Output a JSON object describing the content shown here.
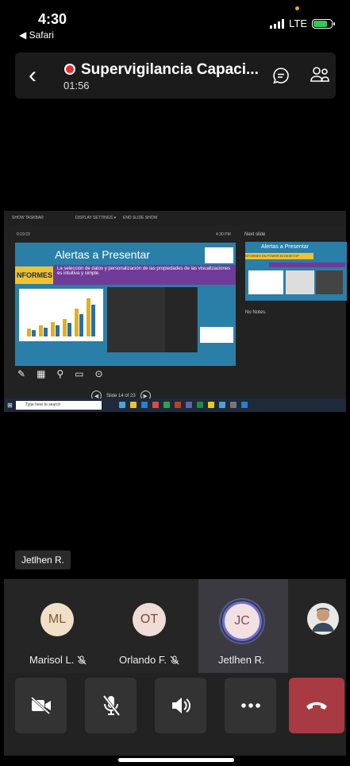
{
  "status_bar": {
    "time": "4:30",
    "back_app": "◀ Safari",
    "network": "LTE"
  },
  "header": {
    "title": "Supervigilancia Capaci...",
    "elapsed": "01:56"
  },
  "shared_screen": {
    "toolbar": [
      "SHOW TASKBAR",
      "DISPLAY SETTINGS ▾",
      "END SLIDE SHOW"
    ],
    "elapsed": "0:19:23",
    "clock": "4:30 PM",
    "slide_title": "Alertas a Presentar",
    "slide_band": "NFORMES EN POWER BI DESKTOP",
    "slide_text": "La selección de datos y personalización de las propiedades de las visualizaciones es intuitiva y simple.",
    "slide_counter": "Slide 14 of 23",
    "next_label": "Next slide",
    "next_title": "Alertas a Presentar",
    "next_band": "NFORMES EN POWER BI DESKTOP",
    "notes": "No Notes.",
    "taskbar_search": "Type here to search"
  },
  "speaker_tag": "Jetlhen R.",
  "participants": [
    {
      "initials": "ML",
      "name": "Marisol L.",
      "muted": true,
      "avatar_color": "#f1dfc8"
    },
    {
      "initials": "OT",
      "name": "Orlando F.",
      "muted": true,
      "avatar_color": "#f0dcd6"
    },
    {
      "initials": "JC",
      "name": "Jetlhen R.",
      "muted": false,
      "avatar_color": "#f3e1e1"
    }
  ],
  "colors": {
    "hangup": "#a83a43",
    "record": "#e5302f",
    "active_ring": "#6b6fd6"
  }
}
